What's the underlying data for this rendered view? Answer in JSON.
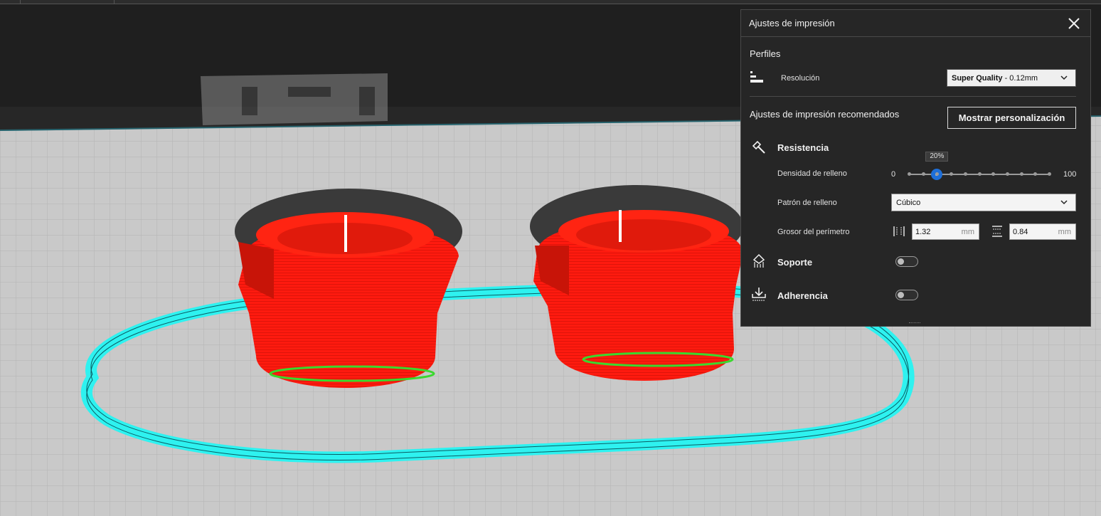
{
  "panel": {
    "title": "Ajustes de impresión",
    "profiles_label": "Perfiles",
    "resolution_label": "Resolución",
    "resolution_value_bold": "Super Quality",
    "resolution_value_rest": " - 0.12mm",
    "recommended_label": "Ajustes de impresión recomendados",
    "custom_button": "Mostrar personalización",
    "strength_label": "Resistencia",
    "infill_density_label": "Densidad de relleno",
    "infill_min": "0",
    "infill_max": "100",
    "infill_value_label": "20%",
    "infill_value": 20,
    "infill_pattern_label": "Patrón de relleno",
    "infill_pattern_value": "Cúbico",
    "wall_thickness_label": "Grosor del perímetro",
    "wall_value": "1.32",
    "wall_unit": "mm",
    "top_bottom_value": "0.84",
    "top_bottom_unit": "mm",
    "support_label": "Soporte",
    "support_enabled": false,
    "adhesion_label": "Adherencia",
    "adhesion_enabled": false
  },
  "colors": {
    "model": "#ff1a0f",
    "skirt": "#2ef2f0",
    "build_plate": "#c8c8c8",
    "accent": "#1e6fd9"
  }
}
